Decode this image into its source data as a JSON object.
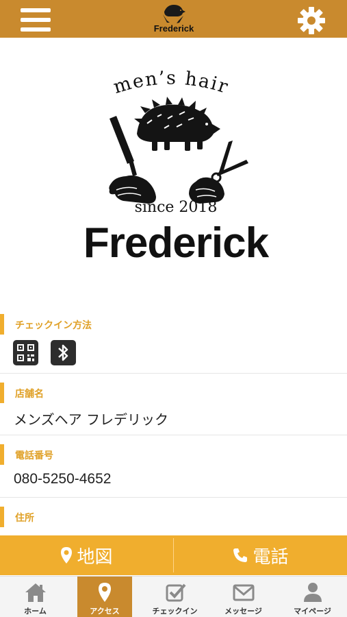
{
  "header": {
    "menu_icon": "hamburger-menu-icon",
    "settings_icon": "gear-icon",
    "logo_text": "Frederick",
    "brand_color": "#c98a2e"
  },
  "hero": {
    "tagline": "men’s hair",
    "since": "since 2018",
    "name": "Frederick"
  },
  "checkin": {
    "title": "チェックイン方法",
    "methods": [
      "qr-code-icon",
      "bluetooth-icon"
    ]
  },
  "shop_name": {
    "title": "店舗名",
    "value": "メンズヘア フレデリック"
  },
  "phone": {
    "title": "電話番号",
    "value": "080-5250-4652"
  },
  "address": {
    "title": "住所"
  },
  "actions": {
    "map_label": "地図",
    "call_label": "電話",
    "accent": "#f0ae2e"
  },
  "tabs": [
    {
      "label": "ホーム",
      "icon": "home-icon"
    },
    {
      "label": "アクセス",
      "icon": "map-pin-icon",
      "active": true
    },
    {
      "label": "チェックイン",
      "icon": "checkbox-icon"
    },
    {
      "label": "メッセージ",
      "icon": "envelope-icon"
    },
    {
      "label": "マイページ",
      "icon": "user-icon"
    }
  ]
}
